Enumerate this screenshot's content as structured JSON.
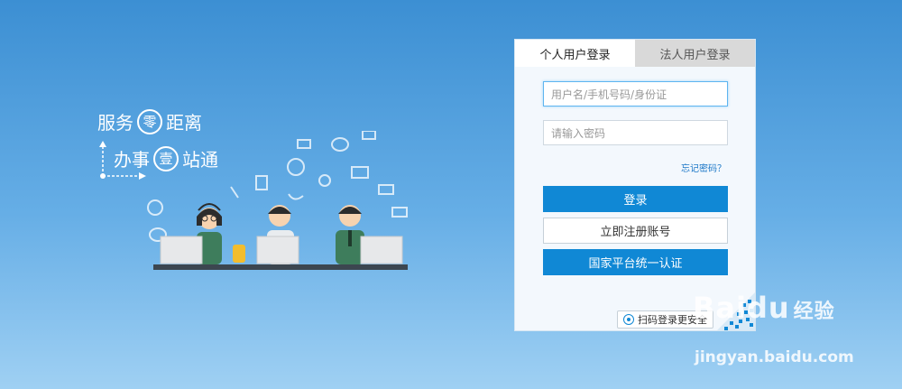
{
  "slogan": {
    "line1_a": "服务",
    "line1_circle": "零",
    "line1_b": "距离",
    "line2_a": "办事",
    "line2_circle": "壹",
    "line2_b": "站通"
  },
  "login": {
    "tabs": [
      {
        "label": "个人用户登录",
        "active": true
      },
      {
        "label": "法人用户登录",
        "active": false
      }
    ],
    "username_placeholder": "用户名/手机号码/身份证",
    "password_placeholder": "请输入密码",
    "forgot_label": "忘记密码？",
    "login_button": "登录",
    "register_button": "立即注册账号",
    "national_auth_button": "国家平台统一认证",
    "qr_login_label": "扫码登录更安全"
  },
  "watermark": {
    "brand": "Baidu",
    "brand_suffix": "经验",
    "url": "jingyan.baidu.com"
  },
  "colors": {
    "accent": "#1088d5",
    "link": "#1b77c7",
    "bg_top": "#3c8fd3",
    "bg_bottom": "#9fd0f3"
  }
}
